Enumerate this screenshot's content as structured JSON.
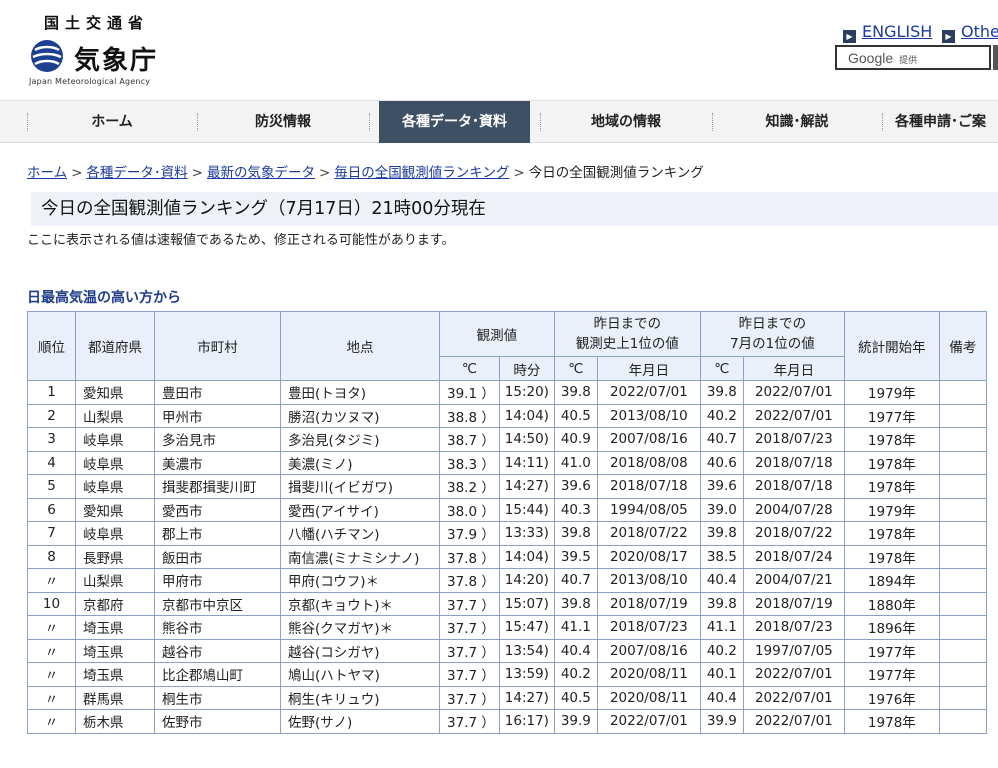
{
  "header": {
    "ministry": "国土交通省",
    "agency_name": "気象庁",
    "agency_name_en": "Japan Meteorological Agency",
    "links": [
      "ENGLISH",
      "Other l"
    ],
    "search": {
      "brand": "Google",
      "suffix": "提供"
    }
  },
  "nav": {
    "items": [
      {
        "label": "ホーム",
        "active": false
      },
      {
        "label": "防災情報",
        "active": false
      },
      {
        "label": "各種データ･資料",
        "active": true
      },
      {
        "label": "地域の情報",
        "active": false
      },
      {
        "label": "知識･解説",
        "active": false
      },
      {
        "label": "各種申請･ご案",
        "active": false
      }
    ]
  },
  "breadcrumb": {
    "links": [
      "ホーム",
      "各種データ･資料",
      "最新の気象データ",
      "毎日の全国観測値ランキング"
    ],
    "current": "今日の全国観測値ランキング"
  },
  "page": {
    "title": "今日の全国観測値ランキング（7月17日）21時00分現在",
    "note": "ここに表示される値は速報値であるため、修正される可能性があります。",
    "section_title": "日最高気温の高い方から"
  },
  "chart_data": {
    "type": "table",
    "title": "日最高気温の高い方から",
    "headers": {
      "rank": "順位",
      "prefecture": "都道府県",
      "city": "市町村",
      "station": "地点",
      "observed": "観測値",
      "observed_temp_unit": "℃",
      "observed_time": "時分",
      "record_all": "昨日までの\n観測史上1位の値",
      "record_all_temp_unit": "℃",
      "record_all_date": "年月日",
      "record_month": "昨日までの\n7月の1位の値",
      "record_month_temp_unit": "℃",
      "record_month_date": "年月日",
      "start_year": "統計開始年",
      "remarks": "備考"
    },
    "rows": [
      {
        "rank": "1",
        "prefecture": "愛知県",
        "city": "豊田市",
        "station": "豊田(トヨタ)",
        "temp": "39.1 ）",
        "time": "15:20)",
        "rec_temp": "39.8",
        "rec_date": "2022/07/01",
        "mon_temp": "39.8",
        "mon_date": "2022/07/01",
        "start": "1979年",
        "note": ""
      },
      {
        "rank": "2",
        "prefecture": "山梨県",
        "city": "甲州市",
        "station": "勝沼(カツヌマ)",
        "temp": "38.8 ）",
        "time": "14:04)",
        "rec_temp": "40.5",
        "rec_date": "2013/08/10",
        "mon_temp": "40.2",
        "mon_date": "2022/07/01",
        "start": "1977年",
        "note": ""
      },
      {
        "rank": "3",
        "prefecture": "岐阜県",
        "city": "多治見市",
        "station": "多治見(タジミ)",
        "temp": "38.7 ）",
        "time": "14:50)",
        "rec_temp": "40.9",
        "rec_date": "2007/08/16",
        "mon_temp": "40.7",
        "mon_date": "2018/07/23",
        "start": "1978年",
        "note": ""
      },
      {
        "rank": "4",
        "prefecture": "岐阜県",
        "city": "美濃市",
        "station": "美濃(ミノ)",
        "temp": "38.3 ）",
        "time": "14:11)",
        "rec_temp": "41.0",
        "rec_date": "2018/08/08",
        "mon_temp": "40.6",
        "mon_date": "2018/07/18",
        "start": "1978年",
        "note": ""
      },
      {
        "rank": "5",
        "prefecture": "岐阜県",
        "city": "揖斐郡揖斐川町",
        "station": "揖斐川(イビガワ)",
        "temp": "38.2 ）",
        "time": "14:27)",
        "rec_temp": "39.6",
        "rec_date": "2018/07/18",
        "mon_temp": "39.6",
        "mon_date": "2018/07/18",
        "start": "1978年",
        "note": ""
      },
      {
        "rank": "6",
        "prefecture": "愛知県",
        "city": "愛西市",
        "station": "愛西(アイサイ)",
        "temp": "38.0 ）",
        "time": "15:44)",
        "rec_temp": "40.3",
        "rec_date": "1994/08/05",
        "mon_temp": "39.0",
        "mon_date": "2004/07/28",
        "start": "1979年",
        "note": ""
      },
      {
        "rank": "7",
        "prefecture": "岐阜県",
        "city": "郡上市",
        "station": "八幡(ハチマン)",
        "temp": "37.9 ）",
        "time": "13:33)",
        "rec_temp": "39.8",
        "rec_date": "2018/07/22",
        "mon_temp": "39.8",
        "mon_date": "2018/07/22",
        "start": "1978年",
        "note": ""
      },
      {
        "rank": "8",
        "prefecture": "長野県",
        "city": "飯田市",
        "station": "南信濃(ミナミシナノ)",
        "temp": "37.8 ）",
        "time": "14:04)",
        "rec_temp": "39.5",
        "rec_date": "2020/08/17",
        "mon_temp": "38.5",
        "mon_date": "2018/07/24",
        "start": "1978年",
        "note": ""
      },
      {
        "rank": "〃",
        "prefecture": "山梨県",
        "city": "甲府市",
        "station": "甲府(コウフ)＊",
        "temp": "37.8 ）",
        "time": "14:20)",
        "rec_temp": "40.7",
        "rec_date": "2013/08/10",
        "mon_temp": "40.4",
        "mon_date": "2004/07/21",
        "start": "1894年",
        "note": ""
      },
      {
        "rank": "10",
        "prefecture": "京都府",
        "city": "京都市中京区",
        "station": "京都(キョウト)＊",
        "temp": "37.7 ）",
        "time": "15:07)",
        "rec_temp": "39.8",
        "rec_date": "2018/07/19",
        "mon_temp": "39.8",
        "mon_date": "2018/07/19",
        "start": "1880年",
        "note": ""
      },
      {
        "rank": "〃",
        "prefecture": "埼玉県",
        "city": "熊谷市",
        "station": "熊谷(クマガヤ)＊",
        "temp": "37.7 ）",
        "time": "15:47)",
        "rec_temp": "41.1",
        "rec_date": "2018/07/23",
        "mon_temp": "41.1",
        "mon_date": "2018/07/23",
        "start": "1896年",
        "note": ""
      },
      {
        "rank": "〃",
        "prefecture": "埼玉県",
        "city": "越谷市",
        "station": "越谷(コシガヤ)",
        "temp": "37.7 ）",
        "time": "13:54)",
        "rec_temp": "40.4",
        "rec_date": "2007/08/16",
        "mon_temp": "40.2",
        "mon_date": "1997/07/05",
        "start": "1977年",
        "note": ""
      },
      {
        "rank": "〃",
        "prefecture": "埼玉県",
        "city": "比企郡鳩山町",
        "station": "鳩山(ハトヤマ)",
        "temp": "37.7 ）",
        "time": "13:59)",
        "rec_temp": "40.2",
        "rec_date": "2020/08/11",
        "mon_temp": "40.1",
        "mon_date": "2022/07/01",
        "start": "1977年",
        "note": ""
      },
      {
        "rank": "〃",
        "prefecture": "群馬県",
        "city": "桐生市",
        "station": "桐生(キリュウ)",
        "temp": "37.7 ）",
        "time": "14:27)",
        "rec_temp": "40.5",
        "rec_date": "2020/08/11",
        "mon_temp": "40.4",
        "mon_date": "2022/07/01",
        "start": "1976年",
        "note": ""
      },
      {
        "rank": "〃",
        "prefecture": "栃木県",
        "city": "佐野市",
        "station": "佐野(サノ)",
        "temp": "37.7 ）",
        "time": "16:17)",
        "rec_temp": "39.9",
        "rec_date": "2022/07/01",
        "mon_temp": "39.9",
        "mon_date": "2022/07/01",
        "start": "1978年",
        "note": ""
      }
    ]
  },
  "colors": {
    "nav_active_bg": "#3e5064",
    "link": "#1a3aa0",
    "section_title": "#1e3c8c",
    "table_border": "#8aa0c6",
    "table_header_bg": "#eaf0fa",
    "title_bg": "#eef2f8"
  }
}
